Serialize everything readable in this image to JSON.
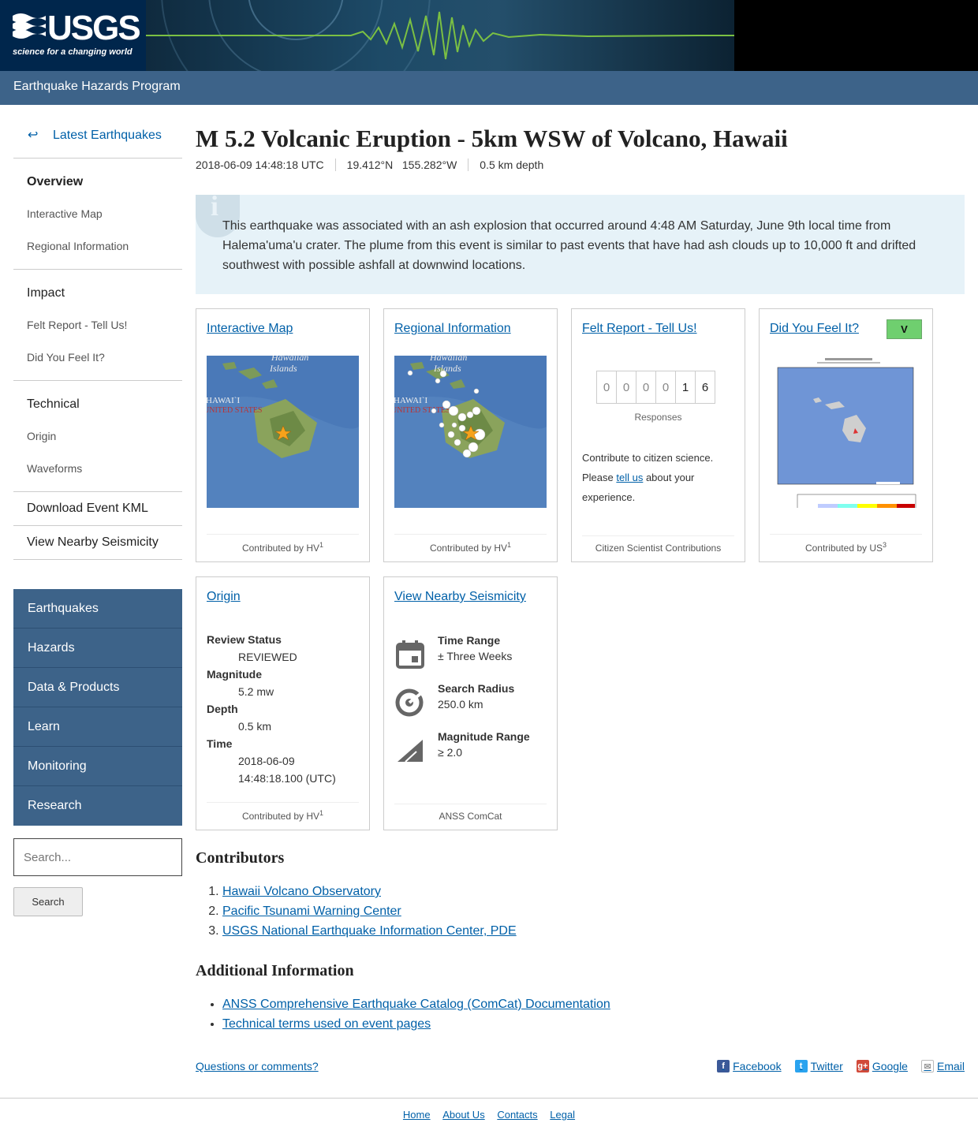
{
  "header": {
    "logo_text": "USGS",
    "logo_tagline": "science for a changing world",
    "program": "Earthquake Hazards Program"
  },
  "sidebar": {
    "latest": "Latest Earthquakes",
    "overview": "Overview",
    "interactive_map": "Interactive Map",
    "regional_info": "Regional Information",
    "impact": "Impact",
    "felt_report": "Felt Report - Tell Us!",
    "dyfi": "Did You Feel It?",
    "technical": "Technical",
    "origin": "Origin",
    "waveforms": "Waveforms",
    "download_kml": "Download Event KML",
    "nearby": "View Nearby Seismicity",
    "nav": [
      "Earthquakes",
      "Hazards",
      "Data & Products",
      "Learn",
      "Monitoring",
      "Research"
    ],
    "search_placeholder": "Search...",
    "search_button": "Search"
  },
  "event": {
    "title": "M 5.2 Volcanic Eruption - 5km WSW of Volcano, Hawaii",
    "time": "2018-06-09 14:48:18 UTC",
    "location": "19.412°N   155.282°W",
    "depth": "0.5 km depth",
    "alert": "This earthquake was associated with an ash explosion that occurred around 4:48 AM Saturday, June 9th local time from Halema'uma'u crater. The plume from this event is similar to past events that have had ash clouds up to 10,000 ft and drifted southwest with possible ashfall at downwind locations."
  },
  "cards": {
    "interactive_map": {
      "title": "Interactive Map",
      "foot": "Contributed by HV",
      "sup": "1",
      "map_label1": "Hawaiian",
      "map_label2": "Islands",
      "map_label3": "HAWAI`I",
      "map_label4": "UNITED STATES"
    },
    "regional": {
      "title": "Regional Information",
      "foot": "Contributed by HV",
      "sup": "1",
      "map_label1": "Hawaiian",
      "map_label2": "Islands",
      "map_label3": "HAWAI`I",
      "map_label4": "UNITED STATES"
    },
    "felt": {
      "title": "Felt Report - Tell Us!",
      "digits": [
        "0",
        "0",
        "0",
        "0",
        "1",
        "6"
      ],
      "responses": "Responses",
      "text1": "Contribute to citizen science.",
      "text2a": "Please ",
      "link": "tell us",
      "text2b": " about your experience.",
      "foot": "Citizen Scientist Contributions"
    },
    "dyfi": {
      "title": "Did You Feel It?",
      "badge": "V",
      "foot": "Contributed by US",
      "sup": "3"
    },
    "origin": {
      "title": "Origin",
      "rows": [
        {
          "k": "Review Status",
          "v": "REVIEWED"
        },
        {
          "k": "Magnitude",
          "v": "5.2 mw"
        },
        {
          "k": "Depth",
          "v": "0.5 km"
        },
        {
          "k": "Time",
          "v": "2018-06-09",
          "v2": "14:48:18.100 (UTC)"
        }
      ],
      "foot": "Contributed by HV",
      "sup": "1"
    },
    "nearby": {
      "title": "View Nearby Seismicity",
      "time_range_k": "Time Range",
      "time_range_v": "± Three Weeks",
      "radius_k": "Search Radius",
      "radius_v": "250.0 km",
      "mag_k": "Magnitude Range",
      "mag_v": "≥ 2.0",
      "foot": "ANSS ComCat"
    }
  },
  "contributors": {
    "heading": "Contributors",
    "items": [
      "Hawaii Volcano Observatory",
      "Pacific Tsunami Warning Center",
      "USGS National Earthquake Information Center, PDE"
    ]
  },
  "additional": {
    "heading": "Additional Information",
    "items": [
      "ANSS Comprehensive Earthquake Catalog (ComCat) Documentation",
      "Technical terms used on event pages"
    ]
  },
  "questions": "Questions or comments?",
  "share": [
    "Facebook",
    "Twitter",
    "Google",
    "Email"
  ],
  "footer": [
    "Home",
    "About Us",
    "Contacts",
    "Legal"
  ],
  "colors": {
    "nav": "#3d6389",
    "link": "#0060a8",
    "alert_bg": "#e6f2f8",
    "dyfi_badge": "#6fcf6f"
  }
}
